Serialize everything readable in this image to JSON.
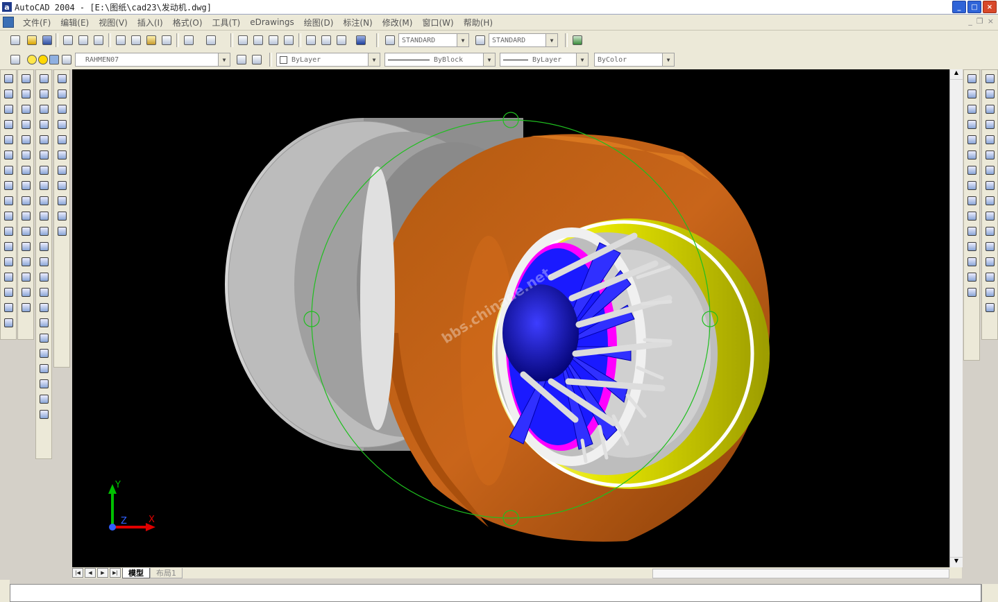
{
  "window": {
    "title": "AutoCAD 2004 - [E:\\图纸\\cad23\\发动机.dwg]",
    "app_icon": "autocad-icon",
    "buttons": [
      "minimize",
      "maximize",
      "close"
    ]
  },
  "menubar": {
    "items": [
      "文件(F)",
      "编辑(E)",
      "视图(V)",
      "插入(I)",
      "格式(O)",
      "工具(T)",
      "eDrawings",
      "绘图(D)",
      "标注(N)",
      "修改(M)",
      "窗口(W)",
      "帮助(H)"
    ]
  },
  "standard_toolbar": {
    "text_style": "STANDARD",
    "dim_style": "STANDARD"
  },
  "layers_toolbar": {
    "current_layer": "RAHMEN07",
    "color": "ByLayer",
    "linetype": "ByBlock",
    "lineweight": "ByLayer",
    "plotstyle": "ByColor"
  },
  "drawing": {
    "watermark": "bbs.chinade.net",
    "ucs": {
      "x_label": "X",
      "y_label": "Y",
      "z_label": "Z"
    },
    "colors": {
      "background": "#000000",
      "nacelle": "#c2600c",
      "inner_ring": "#e6e600",
      "rotor": "#1a1aff",
      "hub": "#0a0aa8",
      "spinner_ring": "#ff00ff",
      "core": "#a6a6a6",
      "orbit": "#1fbf1f"
    }
  },
  "layout_tabs": {
    "items": [
      "模型",
      "布局1"
    ],
    "active": "模型"
  },
  "icons": {
    "draw_toolbar": [
      "line-icon",
      "xline-icon",
      "polyline-icon",
      "polygon-icon",
      "rectangle-icon",
      "arc-icon",
      "circle-icon",
      "revcloud-icon",
      "spline-icon",
      "ellipse-icon",
      "ellipse-arc-icon",
      "insert-block-icon",
      "make-block-icon",
      "point-icon",
      "hatch-icon",
      "region-icon",
      "text-icon"
    ],
    "modify_toolbar": [
      "erase-icon",
      "copy-icon",
      "mirror-icon",
      "offset-icon",
      "array-icon",
      "move-icon",
      "rotate-icon",
      "scale-icon",
      "stretch-icon",
      "trim-icon",
      "extend-icon",
      "break-icon",
      "join-icon",
      "chamfer-icon",
      "fillet-icon",
      "explode-icon"
    ],
    "solids_toolbar": [
      "box-icon",
      "sphere-icon",
      "cylinder-icon",
      "cone-icon",
      "wedge-icon",
      "torus-icon",
      "extrude-icon",
      "revolve-icon",
      "slice-icon",
      "section-icon",
      "interfere-icon",
      "setup-drawing-icon",
      "setup-view-icon",
      "setup-profile-icon",
      "union-icon",
      "subtract-icon",
      "intersect-icon",
      "3dorbit-icon",
      "continuous-orbit-icon",
      "zoom-icon",
      "pan-icon",
      "camera-icon",
      "swivel-icon",
      "clip-icon",
      "adjust-distance-icon"
    ],
    "right_snap_toolbar": [
      "snap-endpoint-icon",
      "snap-midpoint-icon",
      "snap-intersection-icon",
      "snap-apparent-icon",
      "snap-extension-icon",
      "snap-center-icon",
      "snap-quadrant-icon",
      "snap-tangent-icon",
      "snap-perpendicular-icon",
      "snap-parallel-icon",
      "snap-insert-icon",
      "snap-node-icon",
      "snap-nearest-icon",
      "snap-none-icon",
      "osnap-settings-icon"
    ],
    "right_dim_toolbar": [
      "dim-linear-icon",
      "dim-aligned-icon",
      "dim-ordinate-icon",
      "dim-radius-icon",
      "dim-diameter-icon",
      "dim-angular-icon",
      "dim-quick-icon",
      "dim-baseline-icon",
      "dim-continue-icon",
      "dim-leader-icon",
      "dim-tolerance-icon",
      "dim-center-icon",
      "dim-edit-icon",
      "dim-text-edit-icon",
      "dim-update-icon",
      "dim-style-icon"
    ]
  }
}
